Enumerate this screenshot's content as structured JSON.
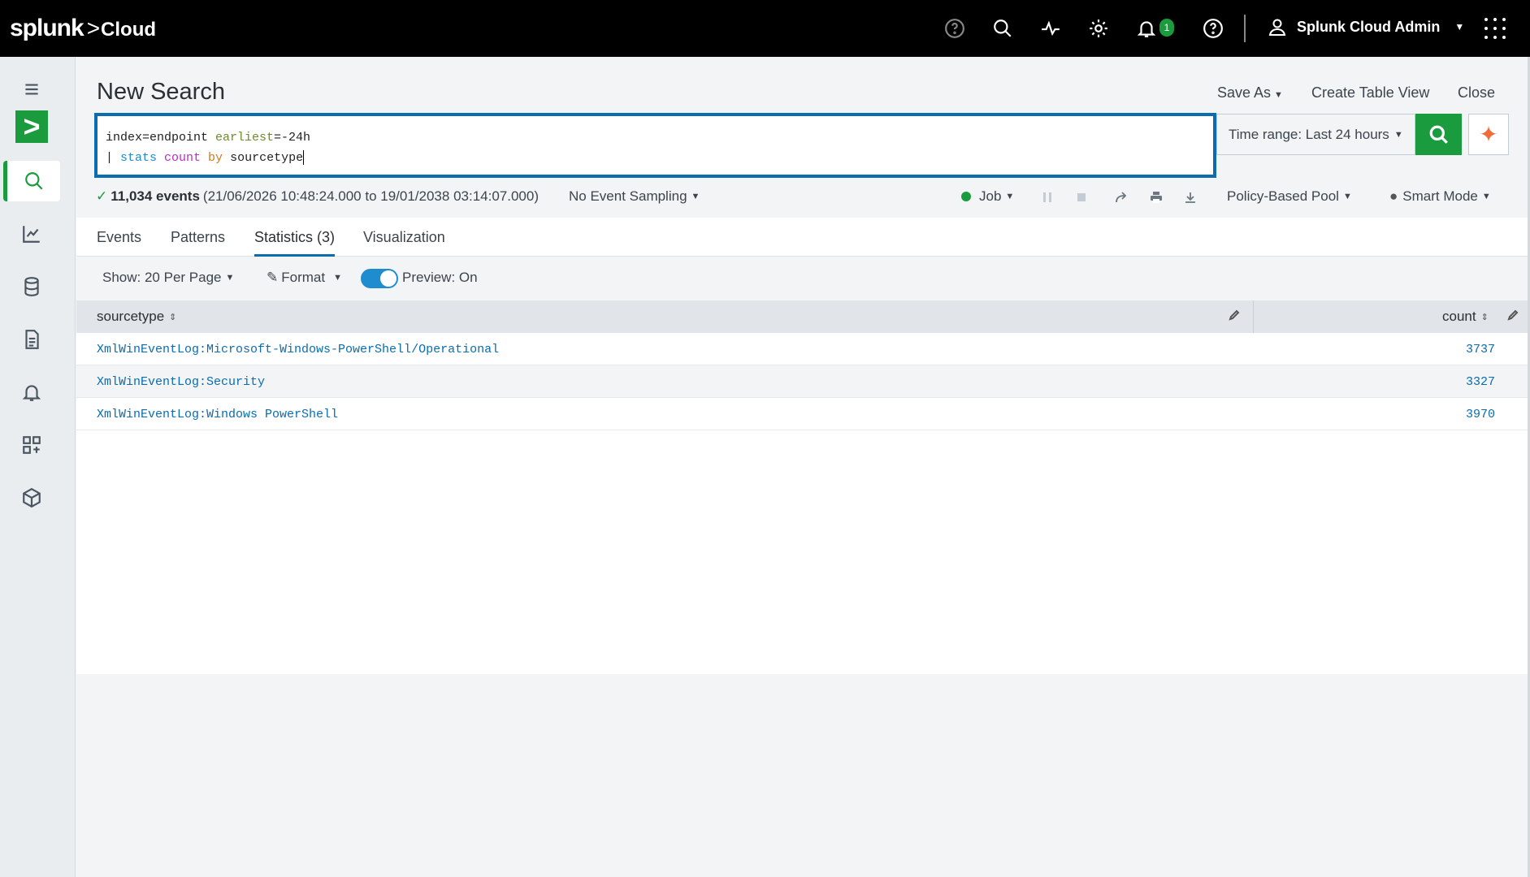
{
  "brand": {
    "name": "splunk",
    "arrow": ">",
    "product": "Cloud"
  },
  "topbar": {
    "notification_count": "1",
    "user_name": "Splunk Cloud Admin"
  },
  "header": {
    "title": "New Search",
    "save_as": "Save As",
    "create_table_view": "Create Table View",
    "close": "Close"
  },
  "search": {
    "line1_a": "index=endpoint ",
    "line1_b": "earliest",
    "line1_c": "=-24h",
    "line2_pipe": "| ",
    "line2_stats": "stats",
    "line2_count": " count ",
    "line2_by": "by",
    "line2_field": " sourcetype",
    "time_range": "Time range: Last 24 hours"
  },
  "status": {
    "check": "✓",
    "events_count": "11,034 events",
    "range_text": "(21/06/2026 10:48:24.000 to 19/01/2038 03:14:07.000)",
    "sampling": "No Event Sampling",
    "job": "Job",
    "pool": "Policy-Based Pool",
    "mode": "Smart Mode"
  },
  "tabs": [
    {
      "label": "Events"
    },
    {
      "label": "Patterns"
    },
    {
      "label": "Statistics (3)"
    },
    {
      "label": "Visualization"
    }
  ],
  "controls": {
    "show": "Show: 20 Per Page",
    "format": "Format",
    "preview": "Preview: On"
  },
  "table": {
    "columns": [
      "sourcetype",
      "count"
    ],
    "rows": [
      {
        "sourcetype": "XmlWinEventLog:Microsoft-Windows-PowerShell/Operational",
        "count": "3737"
      },
      {
        "sourcetype": "XmlWinEventLog:Security",
        "count": "3327"
      },
      {
        "sourcetype": "XmlWinEventLog:Windows PowerShell",
        "count": "3970"
      }
    ]
  },
  "colors": {
    "accent_green": "#1a9c3e",
    "accent_blue": "#0b6cb0",
    "topbar_bg": "#000000"
  }
}
